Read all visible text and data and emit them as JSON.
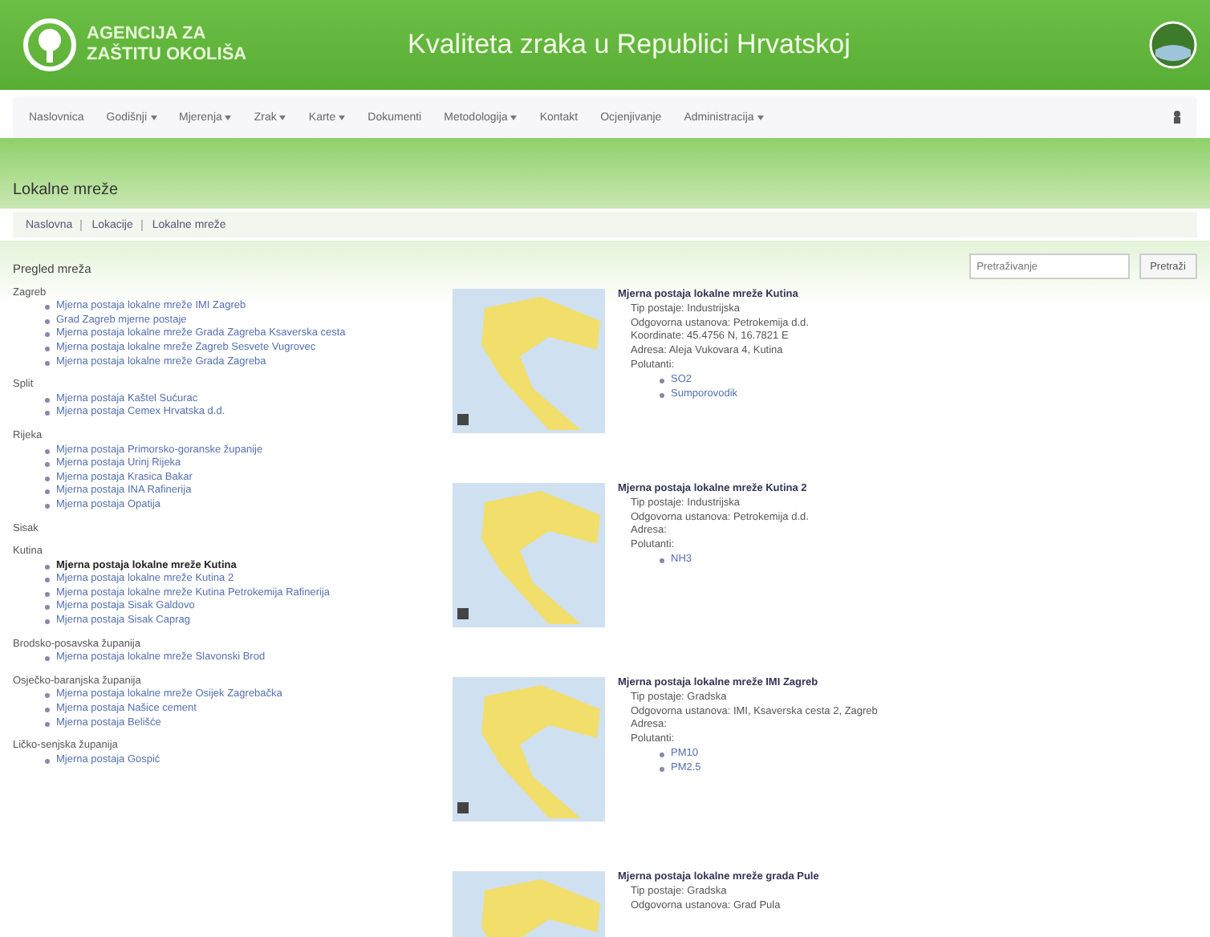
{
  "header": {
    "logo_text": "AGENCIJA ZA ZAŠTITU OKOLIŠA",
    "title": "Kvaliteta zraka u Republici Hrvatskoj"
  },
  "nav": {
    "items": [
      {
        "label": "Naslovnica",
        "dropdown": false
      },
      {
        "label": "Godišnji",
        "dropdown": true
      },
      {
        "label": "Mjerenja",
        "dropdown": true
      },
      {
        "label": "Zrak",
        "dropdown": true
      },
      {
        "label": "Karte",
        "dropdown": true
      },
      {
        "label": "Dokumenti",
        "dropdown": false
      },
      {
        "label": "Metodologija",
        "dropdown": true
      },
      {
        "label": "Kontakt",
        "dropdown": false
      },
      {
        "label": "Ocjenjivanje",
        "dropdown": false
      },
      {
        "label": "Administracija",
        "dropdown": true
      }
    ]
  },
  "page_title": "Lokalne mreže",
  "breadcrumb": [
    "Naslovna",
    "Lokacije",
    "Lokalne mreže"
  ],
  "sidebar": {
    "heading": "Pregled mreža",
    "groups": [
      {
        "title": "Zagreb",
        "items": [
          {
            "label": "Mjerna postaja lokalne mreže IMI Zagreb",
            "selected": false
          },
          {
            "label": "Grad Zagreb mjerne postaje",
            "selected": false
          },
          {
            "label": "Mjerna postaja lokalne mreže Grada Zagreba Ksaverska cesta",
            "selected": false
          },
          {
            "label": "Mjerna postaja lokalne mreže Zagreb Sesvete Vugrovec",
            "selected": false
          },
          {
            "label": "Mjerna postaja lokalne mreže Grada Zagreba",
            "selected": false
          }
        ]
      },
      {
        "title": "Split",
        "items": [
          {
            "label": "Mjerna postaja Kaštel Sućurac",
            "selected": false
          },
          {
            "label": "Mjerna postaja Cemex Hrvatska d.d.",
            "selected": false
          }
        ]
      },
      {
        "title": "Rijeka",
        "items": [
          {
            "label": "Mjerna postaja Primorsko-goranske županije",
            "selected": false
          },
          {
            "label": "Mjerna postaja Urinj Rijeka",
            "selected": false
          },
          {
            "label": "Mjerna postaja Krasica Bakar",
            "selected": false
          },
          {
            "label": "Mjerna postaja INA Rafinerija",
            "selected": false
          },
          {
            "label": "Mjerna postaja Opatija",
            "selected": false
          }
        ]
      },
      {
        "title": "Sisak"
      },
      {
        "title": "Kutina",
        "items": [
          {
            "label": "Mjerna postaja lokalne mreže Kutina",
            "selected": true
          },
          {
            "label": "Mjerna postaja lokalne mreže Kutina 2",
            "selected": false
          },
          {
            "label": "Mjerna postaja lokalne mreže Kutina Petrokemija Rafinerija",
            "selected": false
          },
          {
            "label": "Mjerna postaja Sisak Galdovo",
            "selected": false
          },
          {
            "label": "Mjerna postaja Sisak Caprag",
            "selected": false
          }
        ]
      },
      {
        "title": "Brodsko-posavska županija",
        "items": [
          {
            "label": "Mjerna postaja lokalne mreže Slavonski Brod",
            "selected": false
          }
        ]
      },
      {
        "title": "Osječko-baranjska županija",
        "items": [
          {
            "label": "Mjerna postaja lokalne mreže Osijek Zagrebačka",
            "selected": false
          },
          {
            "label": "Mjerna postaja Našice cement",
            "selected": false
          },
          {
            "label": "Mjerna postaja Belišće",
            "selected": false
          }
        ]
      },
      {
        "title": "Ličko-senjska županija",
        "items": [
          {
            "label": "Mjerna postaja Gospić",
            "selected": false
          }
        ]
      }
    ]
  },
  "search": {
    "placeholder": "Pretraživanje",
    "button": "Pretraži"
  },
  "stations": [
    {
      "title": "Mjerna postaja lokalne mreže Kutina",
      "lines": [
        "Tip postaje: Industrijska",
        "Odgovorna ustanova: Petrokemija d.d.",
        "Koordinate: 45.4756 N, 16.7821 E",
        "Adresa: Aleja Vukovara 4, Kutina",
        "Polutanti:"
      ],
      "links": [
        "SO2",
        "Sumporovodik"
      ]
    },
    {
      "title": "Mjerna postaja lokalne mreže Kutina 2",
      "lines": [
        "Tip postaje: Industrijska",
        "Odgovorna ustanova: Petrokemija d.d.",
        "Adresa:",
        "Polutanti:"
      ],
      "links": [
        "NH3"
      ]
    },
    {
      "title": "Mjerna postaja lokalne mreže IMI Zagreb",
      "lines": [
        "Tip postaje: Gradska",
        "Odgovorna ustanova: IMI, Ksaverska cesta 2, Zagreb",
        "Adresa:",
        "Polutanti:"
      ],
      "links": [
        "PM10",
        "PM2.5"
      ]
    },
    {
      "title": "Mjerna postaja lokalne mreže grada Pule",
      "lines": [
        "Tip postaje: Gradska",
        "Odgovorna ustanova: Grad Pula"
      ]
    }
  ]
}
